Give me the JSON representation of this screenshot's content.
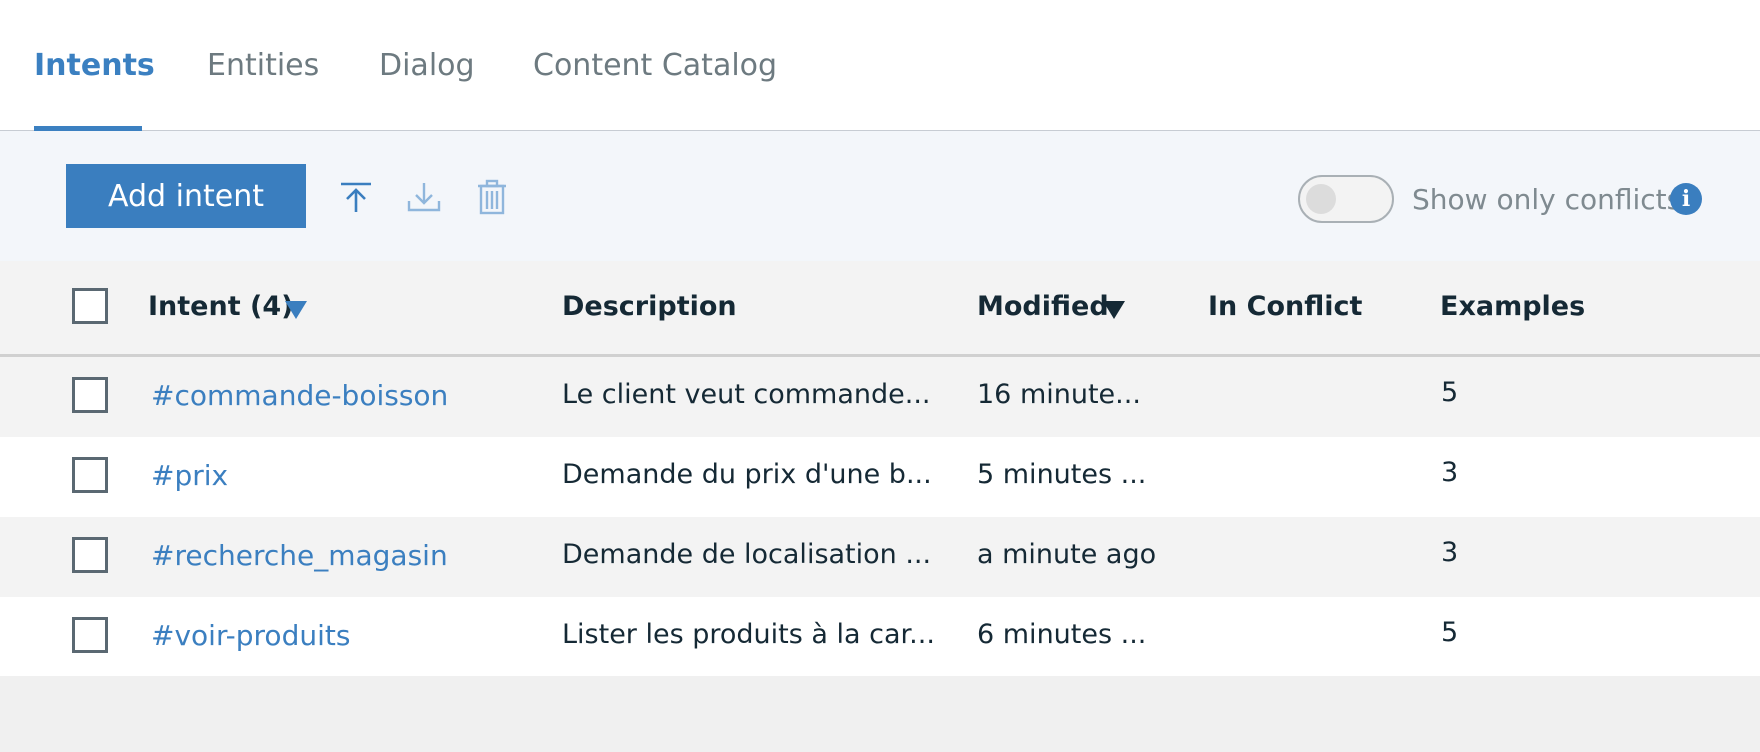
{
  "tabs": [
    {
      "label": "Intents",
      "active": true
    },
    {
      "label": "Entities",
      "active": false
    },
    {
      "label": "Dialog",
      "active": false
    },
    {
      "label": "Content Catalog",
      "active": false
    }
  ],
  "toolbar": {
    "add_label": "Add intent",
    "icons": [
      "upload-icon",
      "download-icon",
      "trash-icon"
    ],
    "toggle_label": "Show only conflicts",
    "toggle_on": false,
    "info_icon": "info-icon"
  },
  "table": {
    "headers": {
      "intent": "Intent (4)",
      "description": "Description",
      "modified": "Modified",
      "conflict": "In Conflict",
      "examples": "Examples"
    },
    "rows": [
      {
        "intent": "#commande-boisson",
        "description": "Le client veut commande...",
        "modified": "16 minute...",
        "conflict": "",
        "examples": "5"
      },
      {
        "intent": "#prix",
        "description": "Demande du prix d'une b...",
        "modified": "5 minutes ...",
        "conflict": "",
        "examples": "3"
      },
      {
        "intent": "#recherche_magasin",
        "description": "Demande de localisation ...",
        "modified": "a minute ago",
        "conflict": "",
        "examples": "3"
      },
      {
        "intent": "#voir-produits",
        "description": "Lister les produits à la car...",
        "modified": "6 minutes ...",
        "conflict": "",
        "examples": "5"
      }
    ]
  },
  "colors": {
    "accent": "#3a7ebf",
    "link": "#3b7fc0",
    "row_alt": "#f3f3f3",
    "row": "#ffffff"
  }
}
